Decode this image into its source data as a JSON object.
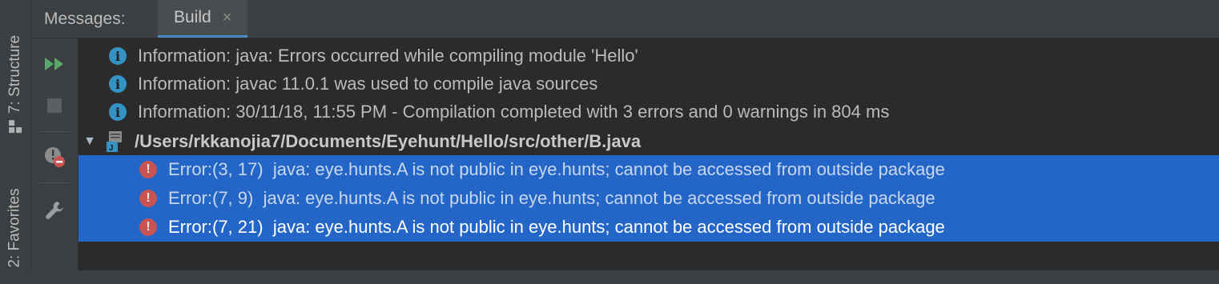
{
  "side_tabs": {
    "structure": "7: Structure",
    "favorites": "2: Favorites"
  },
  "header": {
    "panel_title": "Messages:",
    "active_tab": "Build",
    "close_glyph": "×"
  },
  "toolbar": {
    "items": [
      "rerun-icon",
      "stop-icon",
      "toggle-errors-icon",
      "settings-wrench-icon"
    ]
  },
  "messages": {
    "info": [
      "Information: java: Errors occurred while compiling module 'Hello'",
      "Information: javac 11.0.1 was used to compile java sources",
      "Information: 30/11/18, 11:55 PM - Compilation completed with 3 errors and 0 warnings in 804 ms"
    ],
    "file": {
      "path": "/Users/rkkanojia7/Documents/Eyehunt/Hello/src/other/B.java",
      "expanded": true
    },
    "errors": [
      {
        "pos": "Error:(3, 17)",
        "text": "java: eye.hunts.A is not public in eye.hunts; cannot be accessed from outside package"
      },
      {
        "pos": "Error:(7, 9)",
        "text": "java: eye.hunts.A is not public in eye.hunts; cannot be accessed from outside package"
      },
      {
        "pos": "Error:(7, 21)",
        "text": "java: eye.hunts.A is not public in eye.hunts; cannot be accessed from outside package"
      }
    ]
  },
  "colors": {
    "selection": "#2466c8",
    "info_icon": "#3592c4",
    "error_icon": "#c75450",
    "run_green": "#59a869"
  }
}
